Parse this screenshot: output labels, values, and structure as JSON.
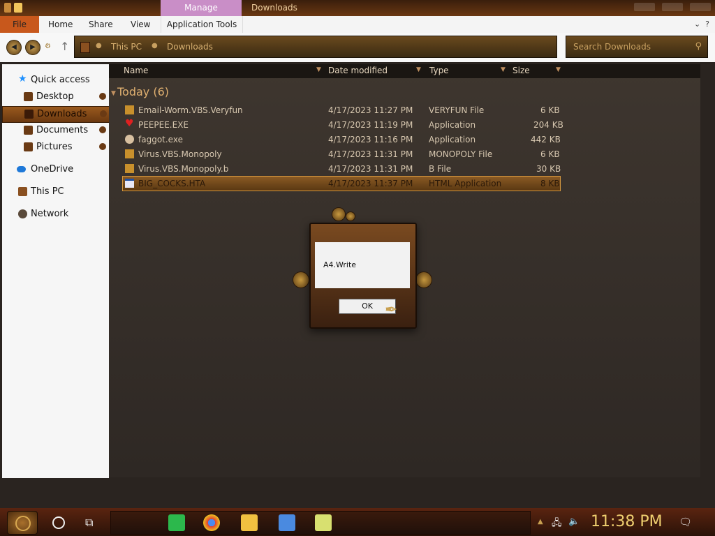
{
  "window": {
    "context_tab": "Manage",
    "title": "Downloads"
  },
  "ribbon": {
    "file": "File",
    "home": "Home",
    "share": "Share",
    "view": "View",
    "app_tools": "Application Tools"
  },
  "address": {
    "crumbs": [
      "This PC",
      "Downloads"
    ]
  },
  "search": {
    "placeholder": "Search Downloads"
  },
  "nav": {
    "items": [
      {
        "label": "Quick access",
        "icon": "star-icon",
        "color": "#1e90ff"
      },
      {
        "label": "Desktop",
        "icon": "desktop-icon",
        "color": "#6a3a14"
      },
      {
        "label": "Downloads",
        "icon": "downloads-icon",
        "color": "#6a3a14"
      },
      {
        "label": "Documents",
        "icon": "documents-icon",
        "color": "#6a3a14"
      },
      {
        "label": "Pictures",
        "icon": "pictures-icon",
        "color": "#6a3a14"
      },
      {
        "label": "OneDrive",
        "icon": "cloud-icon",
        "color": "#1e78d8"
      },
      {
        "label": "This PC",
        "icon": "computer-icon",
        "color": "#6a3a14"
      },
      {
        "label": "Network",
        "icon": "network-icon",
        "color": "#6a3a14"
      }
    ]
  },
  "columns": {
    "name": "Name",
    "date": "Date modified",
    "type": "Type",
    "size": "Size"
  },
  "group": {
    "label": "Today (6)"
  },
  "files": [
    {
      "name": "Email-Worm.VBS.Veryfun",
      "date": "4/17/2023 11:27 PM",
      "type": "VERYFUN File",
      "size": "6 KB",
      "icon": "generic-file-icon"
    },
    {
      "name": "PEEPEE.EXE",
      "date": "4/17/2023 11:19 PM",
      "type": "Application",
      "size": "204 KB",
      "icon": "heart-app-icon"
    },
    {
      "name": "faggot.exe",
      "date": "4/17/2023 11:16 PM",
      "type": "Application",
      "size": "442 KB",
      "icon": "app-icon"
    },
    {
      "name": "Virus.VBS.Monopoly",
      "date": "4/17/2023 11:31 PM",
      "type": "MONOPOLY File",
      "size": "6 KB",
      "icon": "generic-file-icon"
    },
    {
      "name": "Virus.VBS.Monopoly.b",
      "date": "4/17/2023 11:31 PM",
      "type": "B File",
      "size": "30 KB",
      "icon": "generic-file-icon"
    },
    {
      "name": "BIG_COCKS.HTA",
      "date": "4/17/2023 11:37 PM",
      "type": "HTML Application",
      "size": "8 KB",
      "icon": "hta-icon"
    }
  ],
  "dialog": {
    "message": "A4.Write",
    "ok": "OK"
  },
  "taskbar": {
    "clock": "11:38 PM",
    "apps": [
      "notes-app-icon",
      "chrome-icon",
      "file-explorer-icon",
      "cubes-app-icon",
      "notepad-icon"
    ]
  },
  "colors": {
    "accent": "#c8581c",
    "list_text": "#d8c8b0",
    "group_header": "#e0b070",
    "clock": "#f0d070"
  }
}
